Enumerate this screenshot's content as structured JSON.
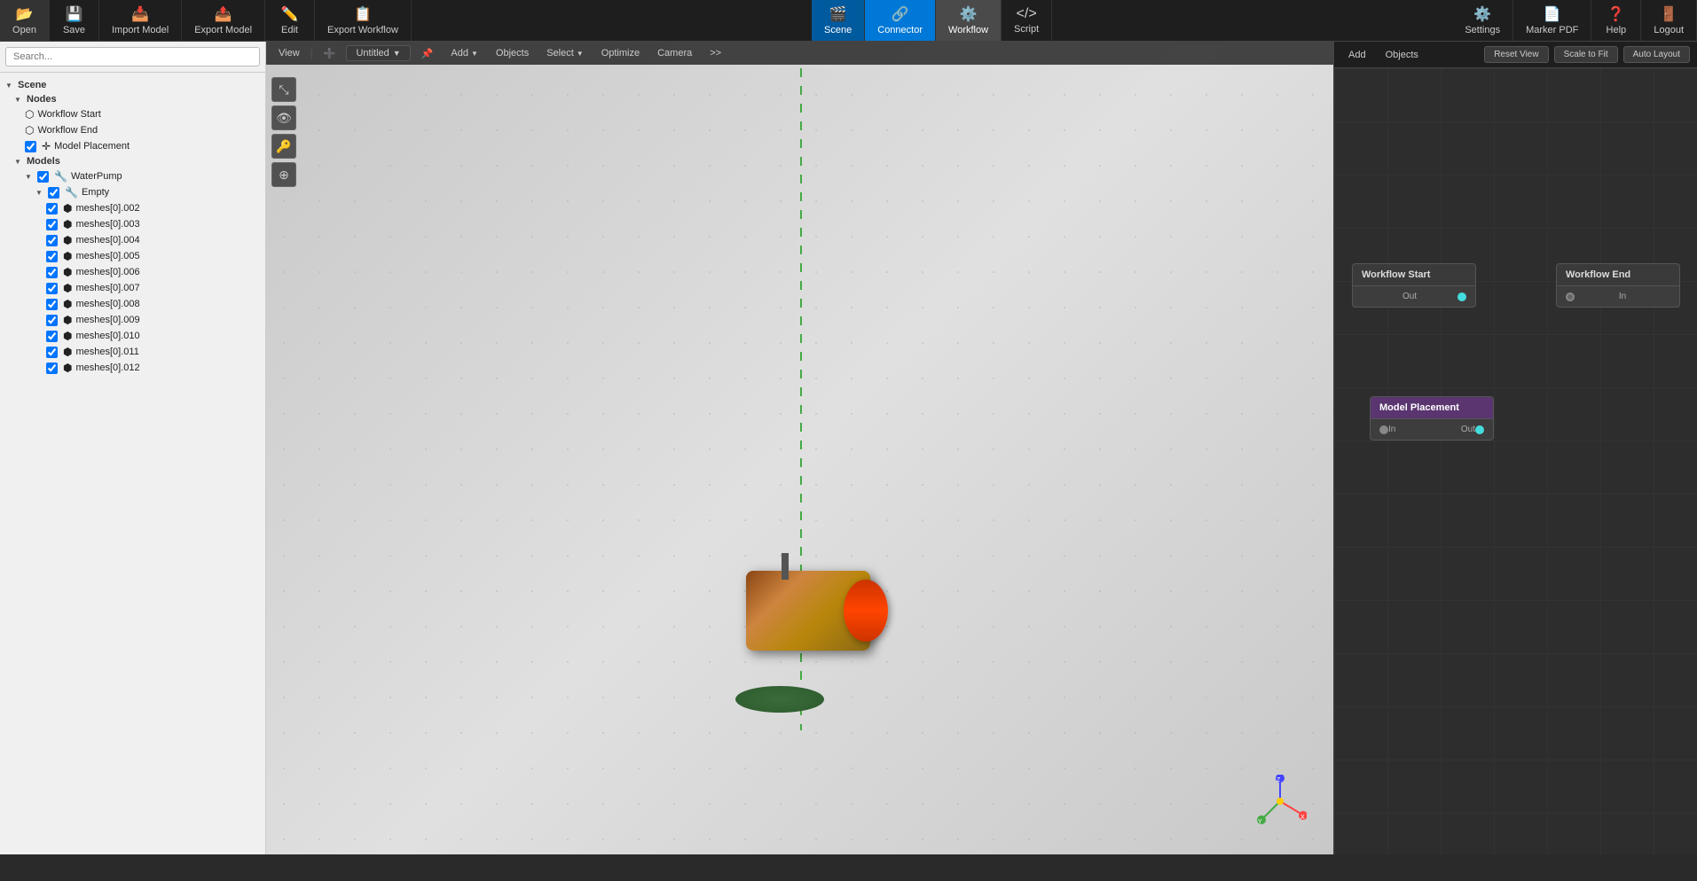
{
  "toolbar": {
    "open": "Open",
    "save": "Save",
    "import_model": "Import Model",
    "export_model": "Export Model",
    "edit": "Edit",
    "export_workflow": "Export Workflow",
    "scene": "Scene",
    "connector": "Connector",
    "workflow": "Workflow",
    "script": "Script",
    "settings": "Settings",
    "marker_pdf": "Marker PDF",
    "help": "Help",
    "logout": "Logout"
  },
  "viewport_toolbar": {
    "view": "View",
    "tab_name": "Untitled",
    "add": "Add",
    "objects": "Objects",
    "select": "Select",
    "optimize": "Optimize",
    "camera": "Camera",
    "more": ">>"
  },
  "workflow_toolbar": {
    "add": "Add",
    "objects": "Objects",
    "reset_view": "Reset View",
    "scale_to_fit": "Scale to Fit",
    "auto_layout": "Auto Layout"
  },
  "sidebar": {
    "search_placeholder": "Search...",
    "scene_label": "Scene",
    "nodes_label": "Nodes",
    "workflow_start": "Workflow Start",
    "workflow_end": "Workflow End",
    "model_placement": "Model Placement",
    "models_label": "Models",
    "water_pump": "WaterPump",
    "empty": "Empty",
    "meshes": [
      "meshes[0].002",
      "meshes[0].003",
      "meshes[0].004",
      "meshes[0].005",
      "meshes[0].006",
      "meshes[0].007",
      "meshes[0].008",
      "meshes[0].009",
      "meshes[0].010",
      "meshes[0].011",
      "meshes[0].012"
    ]
  },
  "workflow": {
    "nodes": {
      "start": {
        "title": "Workflow Start",
        "out_label": "Out"
      },
      "end": {
        "title": "Workflow End",
        "in_label": "In"
      },
      "model_placement": {
        "title": "Model Placement",
        "in_label": "In",
        "out_label": "Out"
      }
    }
  },
  "colors": {
    "accent_blue": "#0078d7",
    "connector_active": "#005a9e",
    "node_purple": "#5a3570",
    "port_cyan": "#4dd9dc",
    "arrow_cyan": "#00bcd4"
  }
}
